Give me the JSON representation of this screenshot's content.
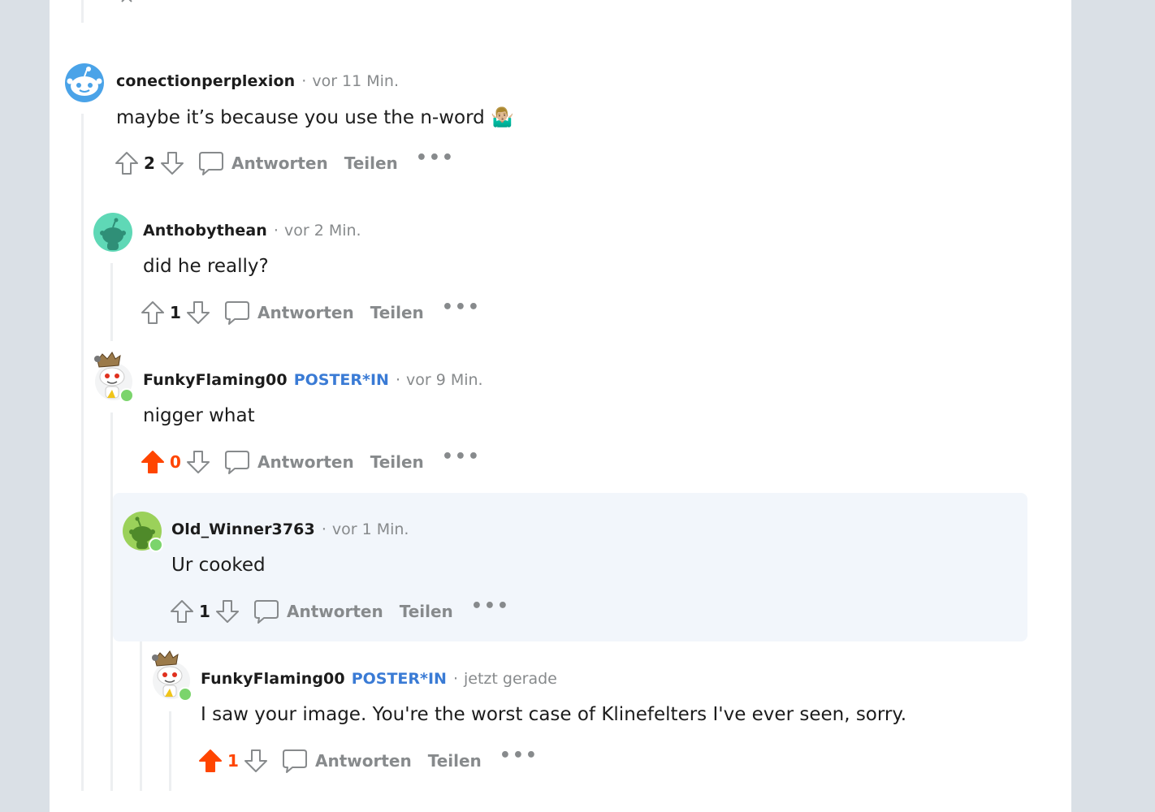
{
  "colors": {
    "background": "#dae0e6",
    "panel": "#ffffff",
    "thread_line": "#edeff1",
    "upvote_active": "#ff4500",
    "op_badge": "#3a7bd5",
    "highlight": "#f2f6fb",
    "muted": "#878a8c"
  },
  "labels": {
    "reply": "Antworten",
    "share": "Teilen",
    "more": "•••",
    "op_badge": "POSTER*IN",
    "separator": "·"
  },
  "comments": [
    {
      "username": "conectionperplexion",
      "time": "vor 11 Min.",
      "text": "maybe it’s because you use the n-word 🤷🏼‍♂️",
      "score": "2",
      "upvoted": false,
      "is_op": false,
      "avatar": "blue-snoo-avatar-icon"
    },
    {
      "username": "Anthobythean",
      "time": "vor 2 Min.",
      "text": "did he really?",
      "score": "1",
      "upvoted": false,
      "is_op": false,
      "avatar": "teal-snoo-avatar-icon"
    },
    {
      "username": "FunkyFlaming00",
      "time": "vor 9 Min.",
      "text": "nigger what",
      "score": "0",
      "upvoted": true,
      "is_op": true,
      "avatar": "custom-snoo-avatar-icon"
    },
    {
      "username": "Old_Winner3763",
      "time": "vor 1 Min.",
      "text": "Ur cooked",
      "score": "1",
      "upvoted": false,
      "is_op": false,
      "avatar": "green-snoo-avatar-icon",
      "highlighted": true
    },
    {
      "username": "FunkyFlaming00",
      "time": "jetzt gerade",
      "text": "I saw your image. You're the worst case of Klinefelters I've ever seen, sorry.",
      "score": "1",
      "upvoted": true,
      "is_op": true,
      "avatar": "custom-snoo-avatar-icon"
    }
  ]
}
